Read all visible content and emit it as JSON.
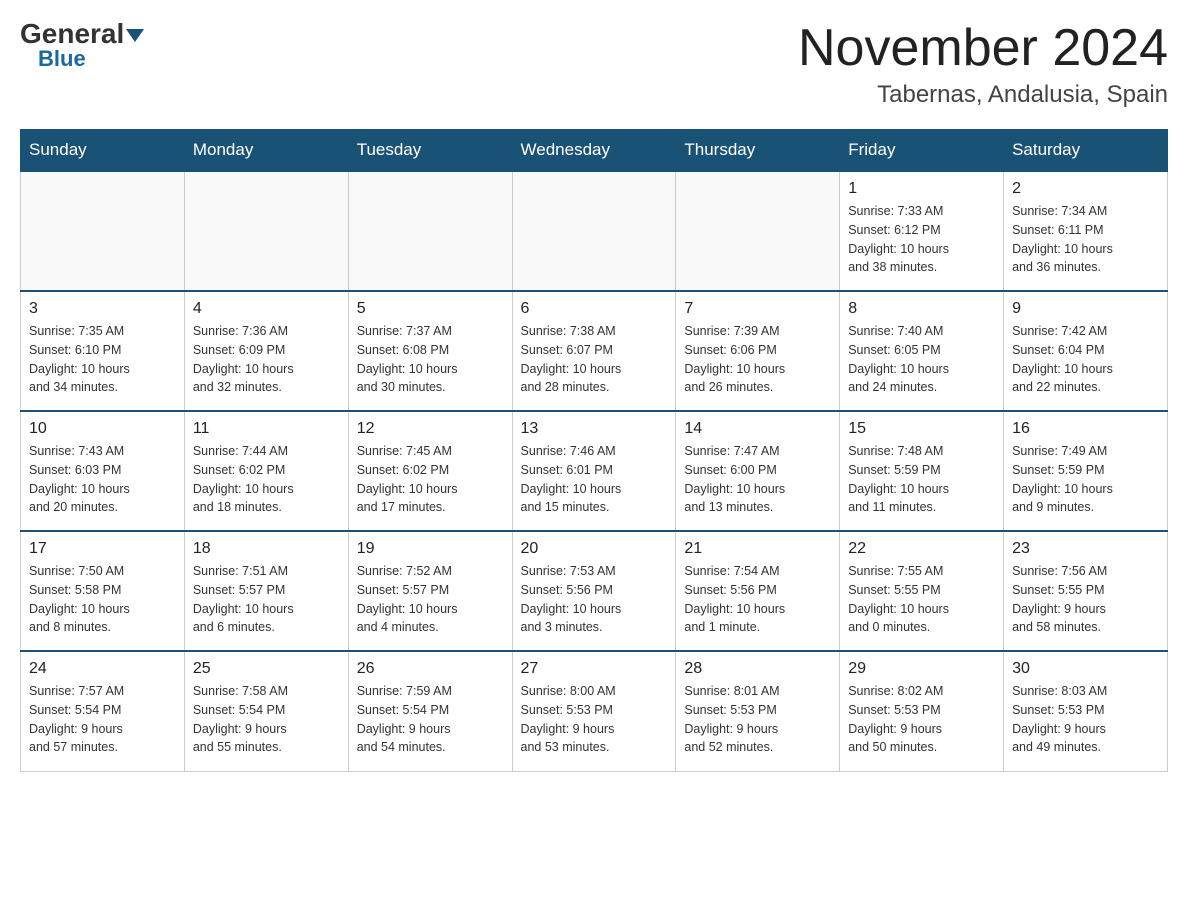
{
  "header": {
    "logo_general": "General",
    "logo_blue": "Blue",
    "month_title": "November 2024",
    "location": "Tabernas, Andalusia, Spain"
  },
  "weekdays": [
    "Sunday",
    "Monday",
    "Tuesday",
    "Wednesday",
    "Thursday",
    "Friday",
    "Saturday"
  ],
  "weeks": [
    [
      {
        "day": "",
        "info": ""
      },
      {
        "day": "",
        "info": ""
      },
      {
        "day": "",
        "info": ""
      },
      {
        "day": "",
        "info": ""
      },
      {
        "day": "",
        "info": ""
      },
      {
        "day": "1",
        "info": "Sunrise: 7:33 AM\nSunset: 6:12 PM\nDaylight: 10 hours\nand 38 minutes."
      },
      {
        "day": "2",
        "info": "Sunrise: 7:34 AM\nSunset: 6:11 PM\nDaylight: 10 hours\nand 36 minutes."
      }
    ],
    [
      {
        "day": "3",
        "info": "Sunrise: 7:35 AM\nSunset: 6:10 PM\nDaylight: 10 hours\nand 34 minutes."
      },
      {
        "day": "4",
        "info": "Sunrise: 7:36 AM\nSunset: 6:09 PM\nDaylight: 10 hours\nand 32 minutes."
      },
      {
        "day": "5",
        "info": "Sunrise: 7:37 AM\nSunset: 6:08 PM\nDaylight: 10 hours\nand 30 minutes."
      },
      {
        "day": "6",
        "info": "Sunrise: 7:38 AM\nSunset: 6:07 PM\nDaylight: 10 hours\nand 28 minutes."
      },
      {
        "day": "7",
        "info": "Sunrise: 7:39 AM\nSunset: 6:06 PM\nDaylight: 10 hours\nand 26 minutes."
      },
      {
        "day": "8",
        "info": "Sunrise: 7:40 AM\nSunset: 6:05 PM\nDaylight: 10 hours\nand 24 minutes."
      },
      {
        "day": "9",
        "info": "Sunrise: 7:42 AM\nSunset: 6:04 PM\nDaylight: 10 hours\nand 22 minutes."
      }
    ],
    [
      {
        "day": "10",
        "info": "Sunrise: 7:43 AM\nSunset: 6:03 PM\nDaylight: 10 hours\nand 20 minutes."
      },
      {
        "day": "11",
        "info": "Sunrise: 7:44 AM\nSunset: 6:02 PM\nDaylight: 10 hours\nand 18 minutes."
      },
      {
        "day": "12",
        "info": "Sunrise: 7:45 AM\nSunset: 6:02 PM\nDaylight: 10 hours\nand 17 minutes."
      },
      {
        "day": "13",
        "info": "Sunrise: 7:46 AM\nSunset: 6:01 PM\nDaylight: 10 hours\nand 15 minutes."
      },
      {
        "day": "14",
        "info": "Sunrise: 7:47 AM\nSunset: 6:00 PM\nDaylight: 10 hours\nand 13 minutes."
      },
      {
        "day": "15",
        "info": "Sunrise: 7:48 AM\nSunset: 5:59 PM\nDaylight: 10 hours\nand 11 minutes."
      },
      {
        "day": "16",
        "info": "Sunrise: 7:49 AM\nSunset: 5:59 PM\nDaylight: 10 hours\nand 9 minutes."
      }
    ],
    [
      {
        "day": "17",
        "info": "Sunrise: 7:50 AM\nSunset: 5:58 PM\nDaylight: 10 hours\nand 8 minutes."
      },
      {
        "day": "18",
        "info": "Sunrise: 7:51 AM\nSunset: 5:57 PM\nDaylight: 10 hours\nand 6 minutes."
      },
      {
        "day": "19",
        "info": "Sunrise: 7:52 AM\nSunset: 5:57 PM\nDaylight: 10 hours\nand 4 minutes."
      },
      {
        "day": "20",
        "info": "Sunrise: 7:53 AM\nSunset: 5:56 PM\nDaylight: 10 hours\nand 3 minutes."
      },
      {
        "day": "21",
        "info": "Sunrise: 7:54 AM\nSunset: 5:56 PM\nDaylight: 10 hours\nand 1 minute."
      },
      {
        "day": "22",
        "info": "Sunrise: 7:55 AM\nSunset: 5:55 PM\nDaylight: 10 hours\nand 0 minutes."
      },
      {
        "day": "23",
        "info": "Sunrise: 7:56 AM\nSunset: 5:55 PM\nDaylight: 9 hours\nand 58 minutes."
      }
    ],
    [
      {
        "day": "24",
        "info": "Sunrise: 7:57 AM\nSunset: 5:54 PM\nDaylight: 9 hours\nand 57 minutes."
      },
      {
        "day": "25",
        "info": "Sunrise: 7:58 AM\nSunset: 5:54 PM\nDaylight: 9 hours\nand 55 minutes."
      },
      {
        "day": "26",
        "info": "Sunrise: 7:59 AM\nSunset: 5:54 PM\nDaylight: 9 hours\nand 54 minutes."
      },
      {
        "day": "27",
        "info": "Sunrise: 8:00 AM\nSunset: 5:53 PM\nDaylight: 9 hours\nand 53 minutes."
      },
      {
        "day": "28",
        "info": "Sunrise: 8:01 AM\nSunset: 5:53 PM\nDaylight: 9 hours\nand 52 minutes."
      },
      {
        "day": "29",
        "info": "Sunrise: 8:02 AM\nSunset: 5:53 PM\nDaylight: 9 hours\nand 50 minutes."
      },
      {
        "day": "30",
        "info": "Sunrise: 8:03 AM\nSunset: 5:53 PM\nDaylight: 9 hours\nand 49 minutes."
      }
    ]
  ]
}
